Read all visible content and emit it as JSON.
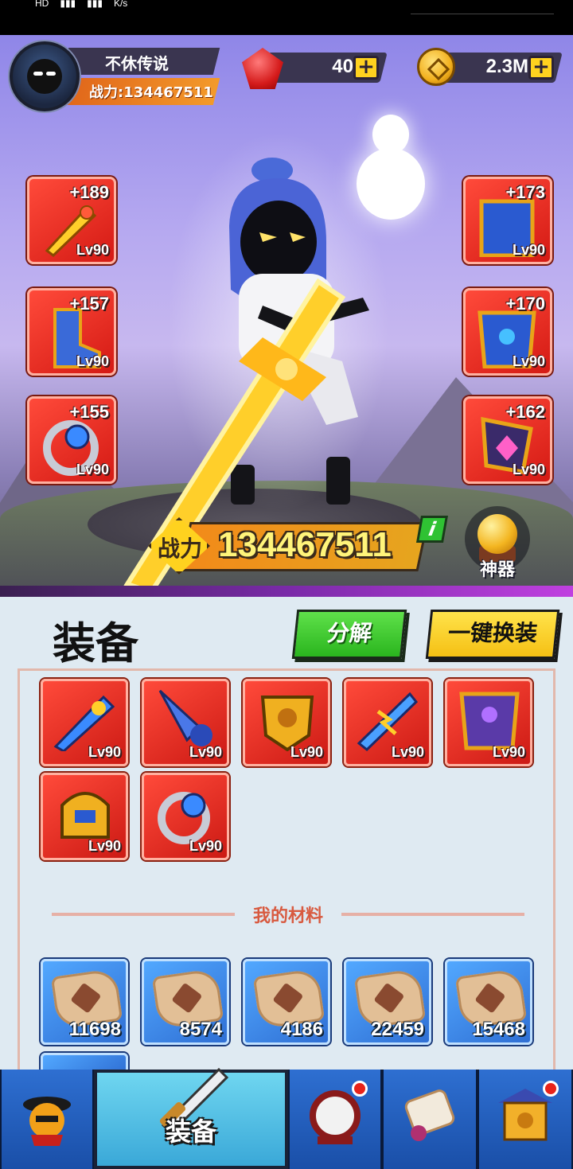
{
  "status_bar": {
    "left_text": "HD",
    "speed_unit": "K/s"
  },
  "player": {
    "name": "不休传说",
    "power_label": "战力:134467511"
  },
  "currency": {
    "gems": "40",
    "gold": "2.3M"
  },
  "colors": {
    "accent_red": "#e8231a",
    "accent_yellow": "#ffd21f",
    "accent_green": "#2ab51e",
    "panel_bg": "#dfeaf2"
  },
  "equipped_left": [
    {
      "icon": "golden-sword-icon",
      "enhance": "+189",
      "level": "Lv90"
    },
    {
      "icon": "boots-icon",
      "enhance": "+157",
      "level": "Lv90"
    },
    {
      "icon": "ring-icon",
      "enhance": "+155",
      "level": "Lv90"
    }
  ],
  "equipped_right": [
    {
      "icon": "helmet-icon",
      "enhance": "+173",
      "level": "Lv90"
    },
    {
      "icon": "armor-icon",
      "enhance": "+170",
      "level": "Lv90"
    },
    {
      "icon": "amulet-icon",
      "enhance": "+162",
      "level": "Lv90"
    }
  ],
  "combat": {
    "label": "战力",
    "value": "134467511",
    "info_label": "i"
  },
  "artifact": {
    "label": "神器"
  },
  "panel": {
    "title": "装备",
    "decompose_label": "分解",
    "auto_equip_label": "一键换装",
    "materials_header": "我的材料"
  },
  "inventory": [
    {
      "icon": "blue-sword-icon",
      "level": "Lv90"
    },
    {
      "icon": "drill-icon",
      "level": "Lv90"
    },
    {
      "icon": "lion-shield-icon",
      "level": "Lv90"
    },
    {
      "icon": "lightning-sword-icon",
      "level": "Lv90"
    },
    {
      "icon": "purple-armor-icon",
      "level": "Lv90"
    },
    {
      "icon": "gold-helmet-icon",
      "level": "Lv90"
    },
    {
      "icon": "blue-ring-icon",
      "level": "Lv90"
    }
  ],
  "materials": [
    {
      "icon": "sword-scroll-icon",
      "count": "11698"
    },
    {
      "icon": "armor-scroll-icon",
      "count": "8574"
    },
    {
      "icon": "ring-scroll-icon",
      "count": "4186"
    },
    {
      "icon": "boots-scroll-icon",
      "count": "22459"
    },
    {
      "icon": "helmet-scroll-icon",
      "count": "15468"
    }
  ],
  "nav": [
    {
      "icon": "hero-icon",
      "label": "",
      "badge": false
    },
    {
      "icon": "equipment-icon",
      "label": "装备",
      "badge": false
    },
    {
      "icon": "drum-icon",
      "label": "",
      "badge": true
    },
    {
      "icon": "scroll-icon",
      "label": "",
      "badge": false
    },
    {
      "icon": "gate-icon",
      "label": "",
      "badge": true
    }
  ]
}
